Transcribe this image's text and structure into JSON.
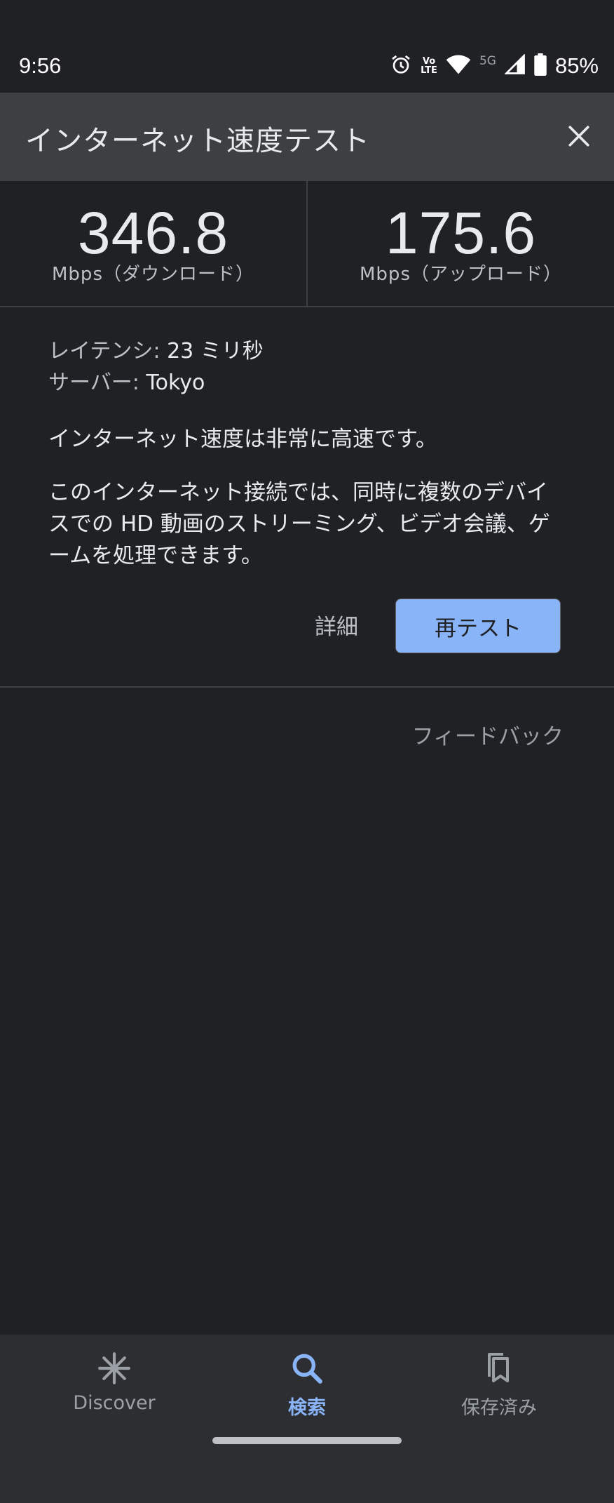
{
  "status_bar": {
    "time": "9:56",
    "volte_top": "Vo",
    "volte_bottom": "LTE",
    "network": "5G",
    "battery": "85%",
    "icons": [
      "alarm-icon",
      "volte-icon",
      "wifi-icon",
      "signal-icon",
      "battery-icon"
    ]
  },
  "header": {
    "title": "インターネット速度テスト",
    "close_icon": "close-icon"
  },
  "results": {
    "download_value": "346.8",
    "download_unit": "Mbps（ダウンロード）",
    "upload_value": "175.6",
    "upload_unit": "Mbps（アップロード）"
  },
  "details": {
    "latency_label": "レイテンシ:",
    "latency_value": "23 ミリ秒",
    "server_label": "サーバー:",
    "server_value": "Tokyo",
    "summary": "インターネット速度は非常に高速です。",
    "description": "このインターネット接続では、同時に複数のデバイスでの HD 動画のストリーミング、ビデオ会議、ゲームを処理できます。"
  },
  "actions": {
    "details_label": "詳細",
    "retest_label": "再テスト",
    "feedback_label": "フィードバック"
  },
  "bottom_nav": {
    "items": [
      {
        "label": "Discover",
        "icon": "discover-icon"
      },
      {
        "label": "検索",
        "icon": "search-icon",
        "active": true
      },
      {
        "label": "保存済み",
        "icon": "bookmarks-icon"
      }
    ]
  },
  "colors": {
    "background": "#202124",
    "header": "#3c4043",
    "accent": "#8ab4f8",
    "bottom_nav": "#2d2e31"
  }
}
